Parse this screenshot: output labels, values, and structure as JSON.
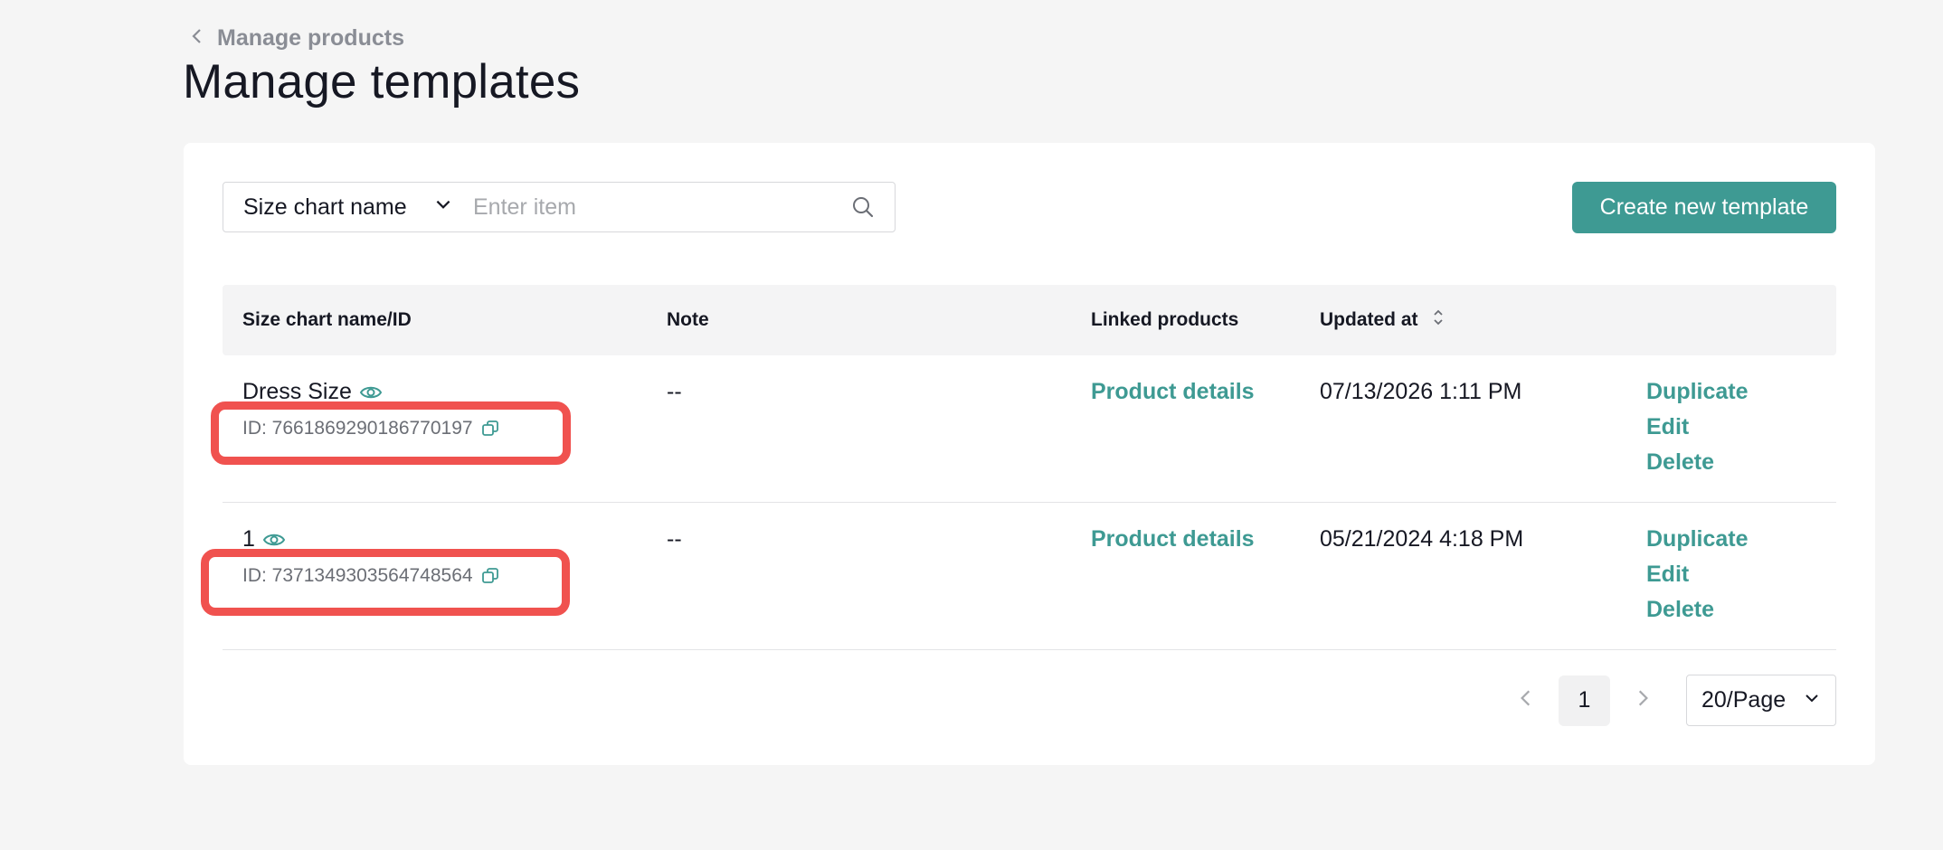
{
  "breadcrumb": {
    "label": "Manage products"
  },
  "page": {
    "title": "Manage templates"
  },
  "search": {
    "filter_label": "Size chart name",
    "placeholder": "Enter item",
    "value": ""
  },
  "toolbar": {
    "create_label": "Create new template"
  },
  "table": {
    "headers": {
      "name": "Size chart name/ID",
      "note": "Note",
      "linked": "Linked products",
      "updated": "Updated at"
    },
    "rows": [
      {
        "name": "Dress Size",
        "id": "ID: 7661869290186770197",
        "note": "--",
        "linked": "Product details",
        "updated": "07/13/2026 1:11 PM",
        "actions": {
          "duplicate": "Duplicate",
          "edit": "Edit",
          "delete": "Delete"
        }
      },
      {
        "name": "1",
        "id": "ID: 7371349303564748564",
        "note": "--",
        "linked": "Product details",
        "updated": "05/21/2024 4:18 PM",
        "actions": {
          "duplicate": "Duplicate",
          "edit": "Edit",
          "delete": "Delete"
        }
      }
    ]
  },
  "pagination": {
    "current_page": "1",
    "page_size": "20/Page"
  },
  "colors": {
    "accent": "#3e9a93",
    "highlight": "#f0524f",
    "background": "#f5f5f5"
  },
  "icons": {
    "back": "chevron-left-icon",
    "filter": "chevron-down-icon",
    "search": "search-icon",
    "preview": "eye-icon",
    "copy": "copy-icon",
    "sort": "sort-icon",
    "prev": "chevron-left-icon",
    "next": "chevron-right-icon"
  }
}
